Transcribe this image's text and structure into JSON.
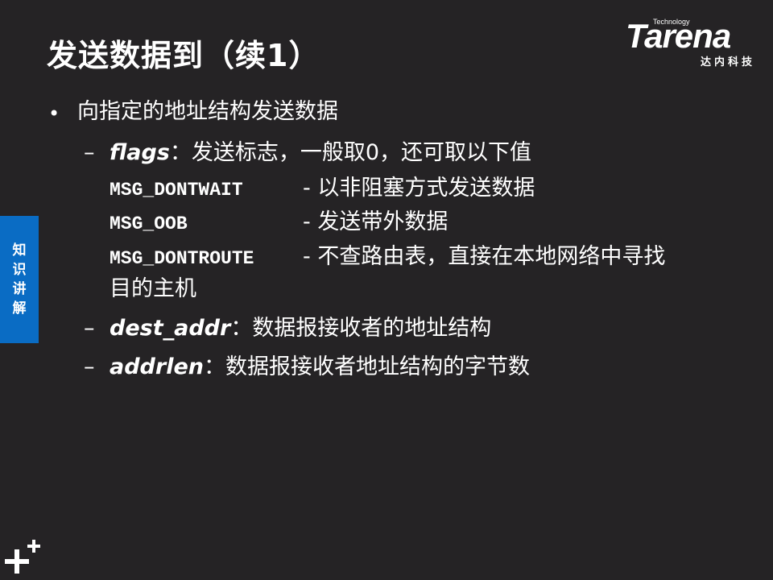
{
  "slide": {
    "title": "发送数据到（续1）",
    "logo": {
      "technology": "Technology",
      "brand": "Tarena",
      "chinese": "达内科技"
    },
    "side_tab": [
      "知",
      "识",
      "讲",
      "解"
    ],
    "bullet": "向指定的地址结构发送数据",
    "items": [
      {
        "dash": "–",
        "term": "flags",
        "sep": "：",
        "text": "发送标志，一般取0，还可取以下值"
      },
      {
        "dash": "–",
        "term": "dest_addr",
        "sep": "：",
        "text": "数据报接收者的地址结构"
      },
      {
        "dash": "–",
        "term": "addrlen",
        "sep": "：",
        "text": "数据报接收者地址结构的字节数"
      }
    ],
    "flags": [
      {
        "name": "MSG_DONTWAIT",
        "desc": "- 以非阻塞方式发送数据"
      },
      {
        "name": "MSG_OOB",
        "desc": "- 发送带外数据"
      },
      {
        "name": "MSG_DONTROUTE",
        "desc": "- 不查路由表，直接在本地网络中寻找"
      }
    ],
    "flag_continuation": "目的主机",
    "colors": {
      "background": "#252325",
      "side_tab": "#0a6cc4",
      "text": "#ffffff"
    }
  }
}
